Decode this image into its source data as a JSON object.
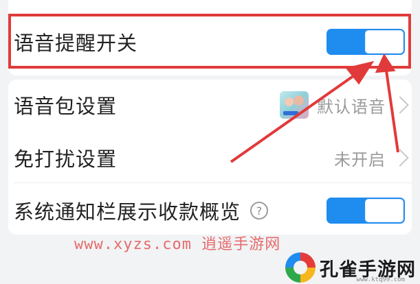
{
  "voice_reminder": {
    "label": "语音提醒开关",
    "enabled": true
  },
  "settings": [
    {
      "label": "语音包设置",
      "value": "默认语音"
    },
    {
      "label": "免打扰设置",
      "value": "未开启"
    },
    {
      "label": "系统通知栏展示收款概览",
      "enabled": true
    }
  ],
  "help_icon_glyph": "?",
  "accent_color": "#1f8cf0",
  "annotation_color": "#e13a3a",
  "watermark": {
    "url": "www.xyzs.com",
    "name": "逍遥手游网"
  },
  "logo": {
    "text": "孔雀手游网",
    "url": "www.ktq99.com"
  }
}
